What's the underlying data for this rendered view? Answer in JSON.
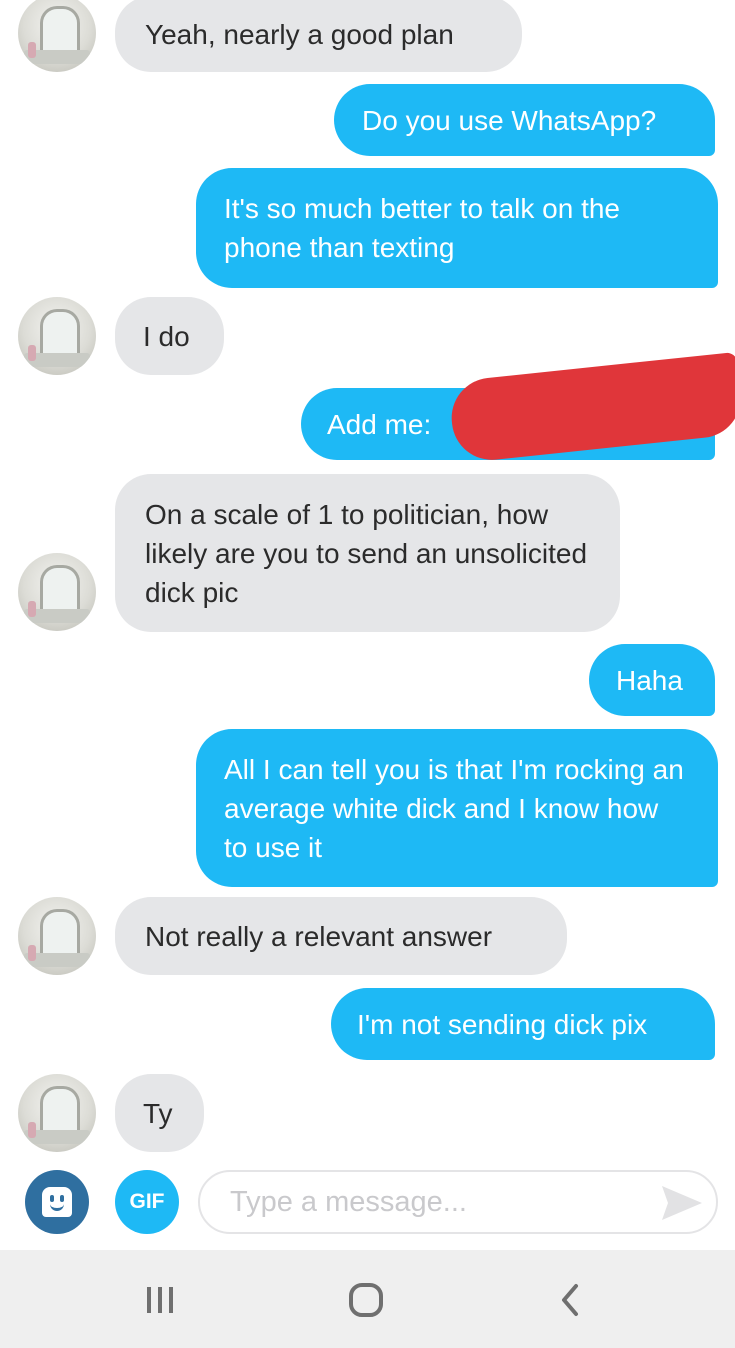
{
  "messages": [
    {
      "from": "them",
      "text": "Yeah, nearly a good plan"
    },
    {
      "from": "me",
      "text": "Do you use WhatsApp?"
    },
    {
      "from": "me",
      "text": "It's so much better to talk on the phone than texting"
    },
    {
      "from": "them",
      "text": "I do"
    },
    {
      "from": "me",
      "text": "Add me:"
    },
    {
      "from": "them",
      "text": "On a scale of 1 to politician, how likely are you to send an unsolicited dick pic"
    },
    {
      "from": "me",
      "text": "Haha"
    },
    {
      "from": "me",
      "text": "All I can tell you is that I'm rocking an average white dick and I know how to use it"
    },
    {
      "from": "them",
      "text": "Not really a relevant answer"
    },
    {
      "from": "me",
      "text": "I'm not sending dick pix"
    },
    {
      "from": "them",
      "text": "Ty"
    }
  ],
  "composer": {
    "gif_label": "GIF",
    "placeholder": "Type a message..."
  },
  "icons": {
    "sticker": "sticker-face-icon",
    "send": "send-arrow-icon",
    "recents": "recent-apps-icon",
    "home": "home-icon",
    "back": "back-chevron-icon"
  },
  "colors": {
    "sent_bubble": "#1eb9f5",
    "received_bubble": "#e5e6e8",
    "redaction": "#e0363a"
  }
}
